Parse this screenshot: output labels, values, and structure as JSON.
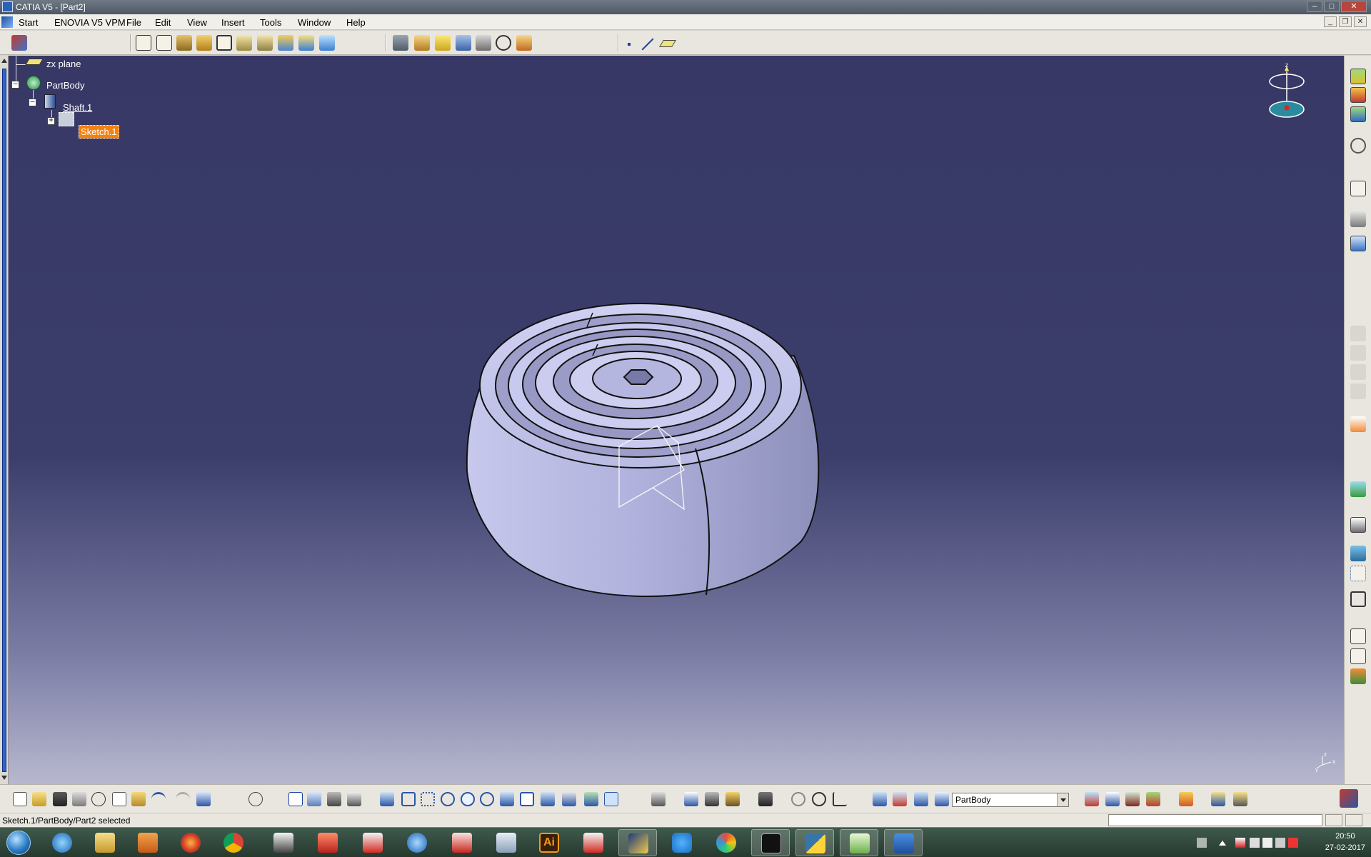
{
  "window": {
    "title": "CATIA V5 - [Part2]",
    "buttons": [
      "minimize",
      "maximize",
      "close"
    ]
  },
  "menu": {
    "items": [
      "Start",
      "ENOVIA V5 VPM",
      "File",
      "Edit",
      "View",
      "Insert",
      "Tools",
      "Window",
      "Help"
    ]
  },
  "tree": {
    "zx_plane": "zx plane",
    "part_body": "PartBody",
    "shaft": "Shaft.1",
    "sketch": "Sketch.1",
    "selected_color": "#f5820f"
  },
  "viewport": {
    "compass_axis_label": "z",
    "axis_labels": [
      "x",
      "y",
      "z"
    ]
  },
  "bottom_toolbar": {
    "current_body": "PartBody"
  },
  "status": {
    "text": "Sketch.1/PartBody/Part2 selected",
    "power_input_value": ""
  },
  "taskbar": {
    "apps": [
      "start",
      "internet-explorer",
      "file-explorer",
      "media-player",
      "firefox",
      "chrome",
      "autodesk",
      "app-red-bird",
      "app-red-doc",
      "app-blue-gear",
      "app-red-slides",
      "app-keyboard",
      "illustrator",
      "app-red-note",
      "app-photo",
      "ccleaner",
      "paint",
      "cmd",
      "python",
      "notepad-app",
      "word"
    ],
    "illustrator_label": "Ai",
    "clock_time": "20:50",
    "clock_date": "27-02-2017"
  },
  "colors": {
    "viewport_top": "#373866",
    "viewport_bottom": "#b7b8cf",
    "part_face": "#b7b8e2",
    "selection": "#f5820f"
  }
}
